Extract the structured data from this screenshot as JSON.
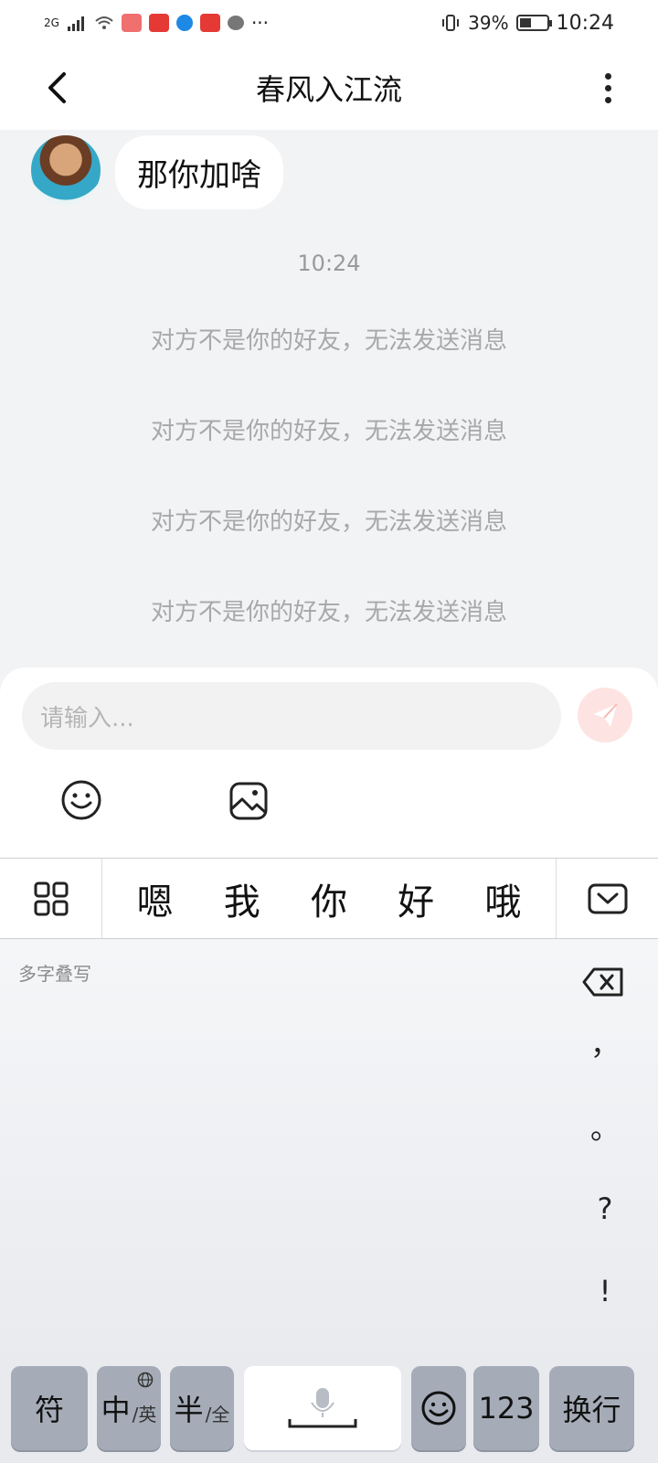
{
  "status_bar": {
    "network": "2G",
    "more_indicator": "···",
    "battery_percent": "39%",
    "time": "10:24"
  },
  "header": {
    "title": "春风入江流"
  },
  "chat": {
    "incoming_message": "那你加啥",
    "timestamp": "10:24",
    "system_messages": [
      "对方不是你的好友，无法发送消息",
      "对方不是你的好友，无法发送消息",
      "对方不是你的好友，无法发送消息",
      "对方不是你的好友，无法发送消息"
    ]
  },
  "input": {
    "placeholder": "请输入..."
  },
  "keyboard": {
    "candidates": [
      "嗯",
      "我",
      "你",
      "好",
      "哦"
    ],
    "handwriting_label": "多字叠写",
    "punctuation": [
      "，",
      "。",
      "?",
      "!"
    ],
    "keys": {
      "symbol": "符",
      "lang_main": "中",
      "lang_alt": "/英",
      "width_main": "半",
      "width_alt": "/全",
      "numbers": "123",
      "enter": "换行"
    }
  },
  "colors": {
    "accent_send": "#f28b82",
    "background": "#f2f3f5",
    "key_gray": "#a5acb8"
  },
  "icons": {
    "back": "chevron-left-icon",
    "more": "more-vertical-icon",
    "send": "paper-plane-icon",
    "emoji": "smiley-icon",
    "image": "image-icon",
    "grid": "grid-icon",
    "collapse": "keyboard-collapse-icon",
    "backspace": "backspace-icon",
    "mic": "mic-icon",
    "globe": "globe-icon"
  }
}
